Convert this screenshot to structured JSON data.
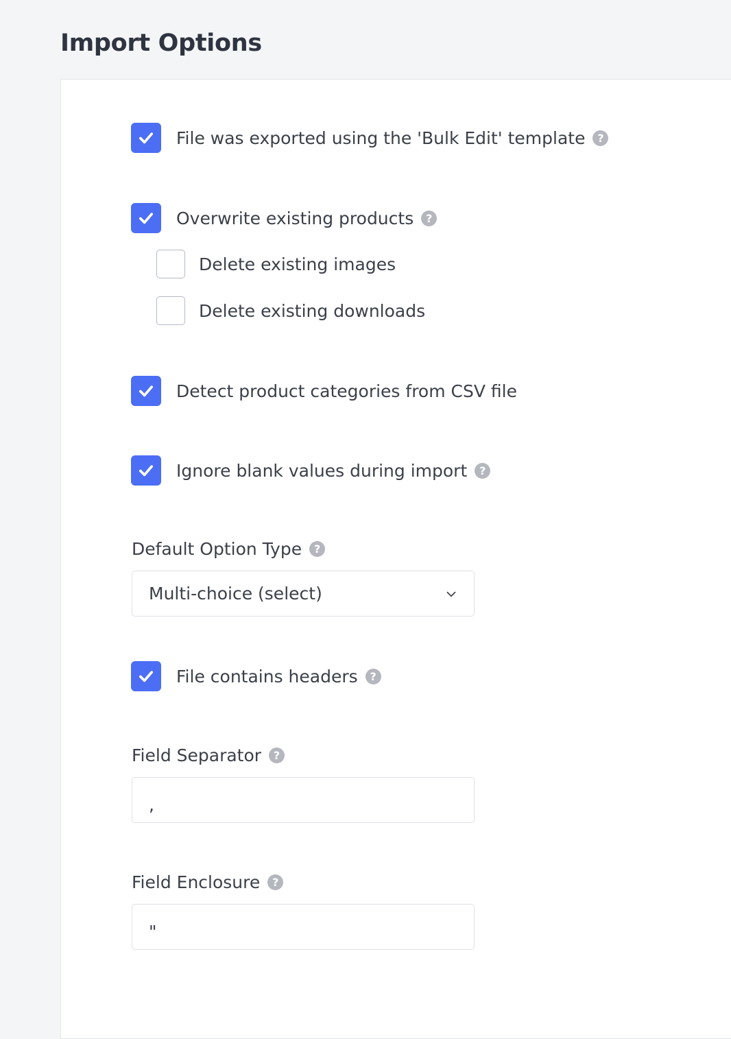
{
  "page": {
    "title": "Import Options",
    "background_color": "#f4f5f7",
    "card_background": "#ffffff",
    "accent_color": "#4c6ef5",
    "text_color": "#3b4049",
    "help_icon_color": "#b4b7bd"
  },
  "options": [
    {
      "id": "bulk-edit-template",
      "label": "File was exported using the 'Bulk Edit' template",
      "checked": true,
      "help": "?",
      "has_help": true,
      "indent": false
    },
    {
      "id": "overwrite-existing-products",
      "label": "Overwrite existing products",
      "checked": true,
      "help": "?",
      "has_help": true,
      "indent": false
    },
    {
      "id": "delete-existing-images",
      "label": "Delete existing images",
      "checked": false,
      "help": "",
      "has_help": false,
      "indent": true
    },
    {
      "id": "delete-existing-downloads",
      "label": "Delete existing downloads",
      "checked": false,
      "help": "",
      "has_help": false,
      "indent": true
    },
    {
      "id": "detect-product-categories",
      "label": "Detect product categories from CSV file",
      "checked": true,
      "help": "",
      "has_help": false,
      "indent": false
    },
    {
      "id": "ignore-blank-values",
      "label": "Ignore blank values during import",
      "checked": true,
      "help": "?",
      "has_help": true,
      "indent": false
    },
    {
      "id": "file-contains-headers",
      "label": "File contains headers",
      "checked": true,
      "help": "?",
      "has_help": true,
      "indent": false
    }
  ],
  "fields": {
    "default_option_type": {
      "label": "Default Option Type",
      "help": "?",
      "value": "Multi-choice (select)",
      "control": "select",
      "icon": "chevron-down-icon"
    },
    "field_separator": {
      "label": "Field Separator",
      "help": "?",
      "value": ",",
      "placeholder": "",
      "control": "text"
    },
    "field_enclosure": {
      "label": "Field Enclosure",
      "help": "?",
      "value": "\"",
      "placeholder": "",
      "control": "text"
    }
  }
}
